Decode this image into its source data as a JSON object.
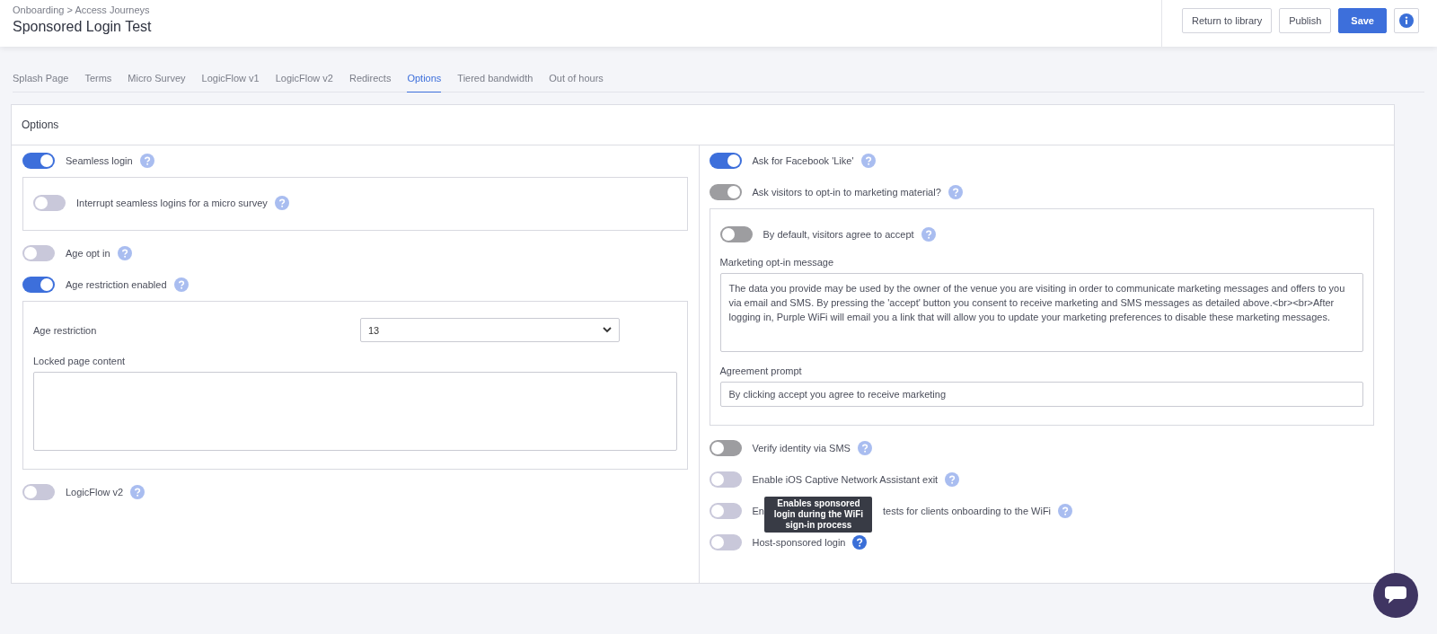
{
  "header": {
    "breadcrumb": "Onboarding > Access Journeys",
    "title": "Sponsored Login Test",
    "buttons": [
      {
        "label": "Return to library",
        "kind": "default"
      },
      {
        "label": "Publish",
        "kind": "default"
      },
      {
        "label": "Save",
        "kind": "primary"
      },
      {
        "kind": "info"
      }
    ]
  },
  "tabs": [
    {
      "label": "Splash Page",
      "selected": false
    },
    {
      "label": "Terms",
      "selected": false
    },
    {
      "label": "Micro Survey",
      "selected": false
    },
    {
      "label": "LogicFlow v1",
      "selected": false
    },
    {
      "label": "LogicFlow v2",
      "selected": false
    },
    {
      "label": "Redirects",
      "selected": false
    },
    {
      "label": "Options",
      "selected": true
    },
    {
      "label": "Tiered bandwidth",
      "selected": false
    },
    {
      "label": "Out of hours",
      "selected": false
    }
  ],
  "panel": {
    "title": "Options",
    "left": [
      {
        "kind": "toggle",
        "label": "Seamless login",
        "on": true,
        "disabled": false,
        "help_active": false,
        "panel": [
          {
            "kind": "toggle",
            "label": "Interrupt seamless logins for a micro survey",
            "on": false,
            "disabled": false,
            "help_active": false
          }
        ]
      },
      {
        "kind": "toggle",
        "label": "Age opt in",
        "on": false,
        "disabled": false,
        "help_active": false
      },
      {
        "kind": "toggle",
        "label": "Age restriction enabled",
        "on": true,
        "disabled": false,
        "help_active": false,
        "panel": [
          {
            "kind": "select",
            "label": "Age restriction",
            "value": "13"
          },
          {
            "kind": "textarea",
            "label": "Locked page content"
          }
        ]
      },
      {
        "kind": "toggle",
        "label": "LogicFlow v2",
        "on": false,
        "disabled": false,
        "help_active": false
      }
    ],
    "right": [
      {
        "kind": "toggle",
        "label": "Ask for Facebook 'Like'",
        "on": true,
        "disabled": false,
        "help_active": false
      },
      {
        "kind": "toggle",
        "label": "Ask visitors to opt-in to marketing material?",
        "on": true,
        "disabled": true,
        "help_active": false,
        "panel": [
          {
            "kind": "toggle",
            "label": "By default, visitors agree to accept",
            "on": false,
            "disabled": true,
            "help_active": false
          },
          {
            "kind": "textarea",
            "label": "Marketing opt-in message",
            "value": "The data you provide may be used by the owner of the venue you are visiting in order to communicate marketing messages and offers to you via email and SMS. By pressing the 'accept' button you consent to receive marketing and SMS messages as detailed above.<br><br>After logging in, Purple WiFi will email you a link that will allow you to update your marketing preferences to disable these marketing messages."
          },
          {
            "kind": "input",
            "label": "Agreement prompt",
            "value": "By clicking accept you agree to receive marketing"
          }
        ]
      },
      {
        "kind": "toggle",
        "label": "Verify identity via SMS",
        "on": false,
        "disabled": true,
        "help_active": false
      },
      {
        "kind": "toggle",
        "label": "Enable iOS Captive Network Assistant exit",
        "on": false,
        "disabled": false,
        "help_active": false
      },
      {
        "kind": "toggle",
        "label_parts": [
          "En",
          "tests for clients onboarding to the WiFi"
        ],
        "on": false,
        "disabled": false,
        "help_active": false
      },
      {
        "kind": "toggle",
        "label": "Host-sponsored login",
        "on": false,
        "disabled": false,
        "help_active": true,
        "tooltip": "Enables sponsored login during the WiFi sign-in process"
      }
    ]
  },
  "chat": {
    "kind": "chat"
  }
}
